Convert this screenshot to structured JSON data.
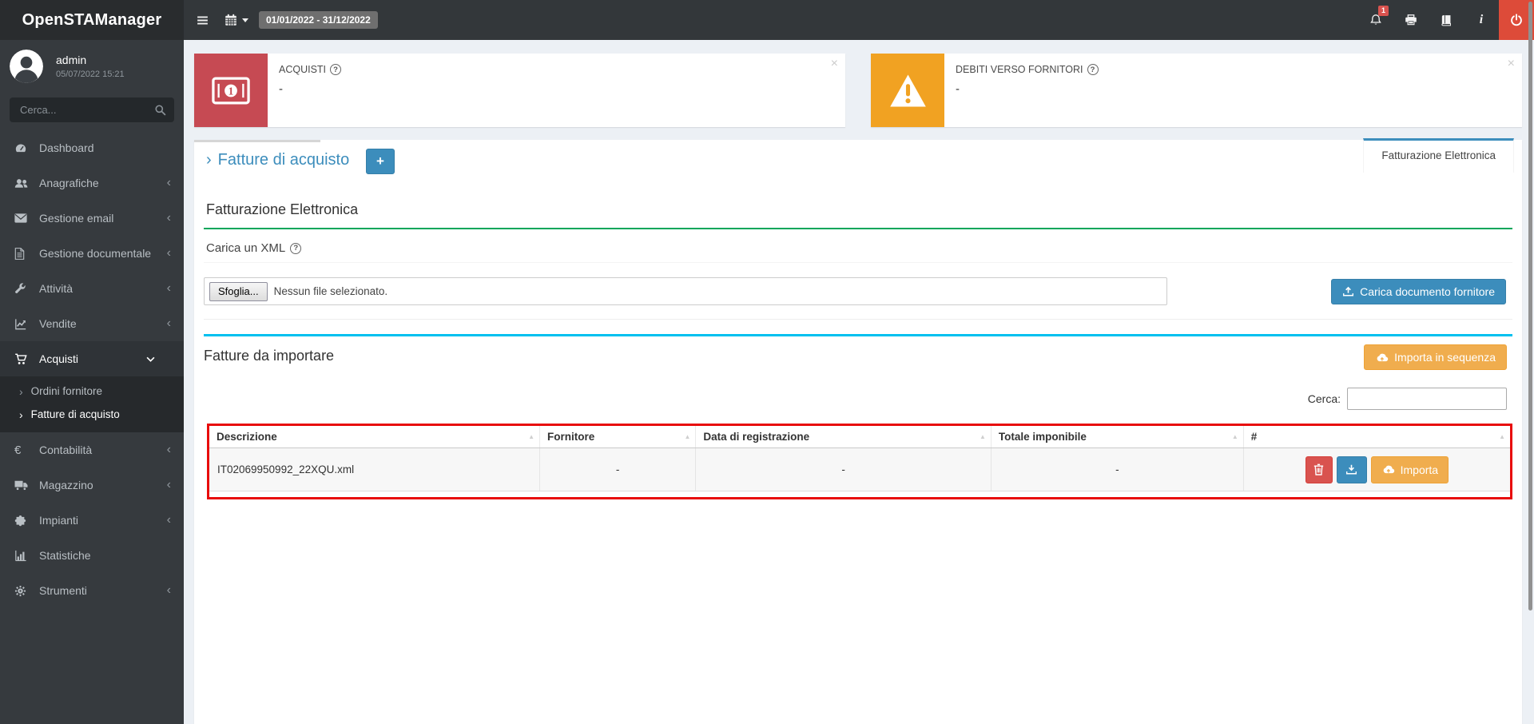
{
  "topbar": {
    "logo": "OpenSTAManager",
    "date_range": "01/01/2022 - 31/12/2022",
    "notification_count": "1"
  },
  "sidebar": {
    "user": {
      "name": "admin",
      "datetime": "05/07/2022 15:21"
    },
    "search": {
      "placeholder": "Cerca..."
    },
    "items": [
      {
        "label": "Dashboard",
        "icon": "gauge"
      },
      {
        "label": "Anagrafiche",
        "icon": "users"
      },
      {
        "label": "Gestione email",
        "icon": "envelope"
      },
      {
        "label": "Gestione documentale",
        "icon": "file"
      },
      {
        "label": "Attività",
        "icon": "wrench"
      },
      {
        "label": "Vendite",
        "icon": "chart-line"
      },
      {
        "label": "Acquisti",
        "icon": "cart"
      },
      {
        "label": "Contabilità",
        "icon": "euro"
      },
      {
        "label": "Magazzino",
        "icon": "truck"
      },
      {
        "label": "Impianti",
        "icon": "puzzle"
      },
      {
        "label": "Statistiche",
        "icon": "bar-chart"
      },
      {
        "label": "Strumenti",
        "icon": "gear"
      }
    ],
    "submenu": {
      "items": [
        {
          "label": "Ordini fornitore"
        },
        {
          "label": "Fatture di acquisto"
        }
      ]
    }
  },
  "info_boxes": [
    {
      "title": "ACQUISTI",
      "value": "-",
      "color": "#c64a53",
      "icon": "money-bill"
    },
    {
      "title": "DEBITI VERSO FORNITORI",
      "value": "-",
      "color": "#f1a222",
      "icon": "warning"
    }
  ],
  "page_header": {
    "arrow": "›",
    "title": "Fatture di acquisto",
    "add_label": "+",
    "tab": "Fatturazione Elettronica"
  },
  "fe_section": {
    "title": "Fatturazione Elettronica"
  },
  "upload": {
    "title": "Carica un XML",
    "browse_label": "Sfoglia...",
    "file_status": "Nessun file selezionato.",
    "button_label": "Carica documento fornitore"
  },
  "import_section": {
    "title": "Fatture da importare",
    "batch_button": "Importa in sequenza",
    "search_label": "Cerca:",
    "search_value": ""
  },
  "table": {
    "columns": {
      "descrizione": "Descrizione",
      "fornitore": "Fornitore",
      "data_registrazione": "Data di registrazione",
      "totale_imponibile": "Totale imponibile",
      "numero": "#"
    },
    "row": {
      "descrizione": "IT02069950992_22XQU.xml",
      "fornitore": "-",
      "data_registrazione": "-",
      "totale_imponibile": "-",
      "import_label": "Importa"
    }
  },
  "misc": {
    "close_label": "×",
    "help_label": "?"
  },
  "colors": {
    "primary": "#3c8dbc",
    "success": "#00a65a",
    "info": "#00c0ef",
    "warning": "#f0ad4e",
    "danger": "#d9534f",
    "boxred": "#c64a53",
    "boxyellow": "#f1a222",
    "highlight": "#e80c0c",
    "powerred": "#dd4b39"
  }
}
